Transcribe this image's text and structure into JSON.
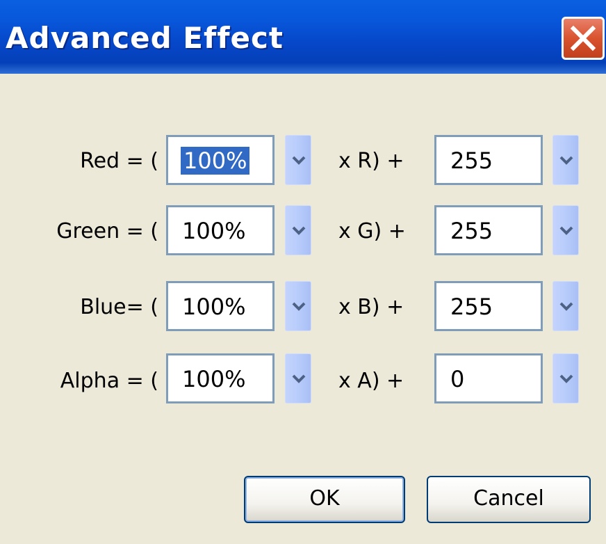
{
  "window": {
    "title": "Advanced Effect"
  },
  "rows": [
    {
      "label": "Red = (",
      "percent": "100%",
      "mid": "x R) +",
      "offset": "255"
    },
    {
      "label": "Green = (",
      "percent": "100%",
      "mid": "x G) +",
      "offset": "255"
    },
    {
      "label": "Blue= (",
      "percent": "100%",
      "mid": "x B) +",
      "offset": "255"
    },
    {
      "label": "Alpha = (",
      "percent": "100%",
      "mid": "x A) +",
      "offset": "0"
    }
  ],
  "buttons": {
    "ok": "OK",
    "cancel": "Cancel"
  },
  "colors": {
    "titlebar": "#0858dc",
    "dialog_bg": "#ece9d8",
    "selection": "#316ac5",
    "close_button": "#d9532f"
  }
}
